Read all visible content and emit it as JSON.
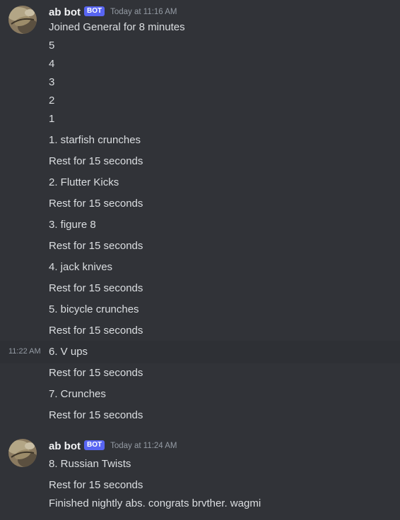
{
  "messages": [
    {
      "author": "ab bot",
      "tag": "BOT",
      "timestamp": "Today at 11:16 AM",
      "lines": [
        "Joined General for 8 minutes",
        "5",
        "4",
        "3",
        "2",
        "1",
        "1. starfish crunches",
        "Rest for 15 seconds",
        "2. Flutter Kicks",
        "Rest for 15 seconds",
        "3. figure 8",
        "Rest for 15 seconds",
        "4. jack knives",
        "Rest for 15 seconds",
        "5. bicycle crunches",
        "Rest for 15 seconds",
        "6. V ups",
        "Rest for 15 seconds",
        "7. Crunches",
        "Rest for 15 seconds"
      ],
      "hovered_line_time": "11:22 AM"
    },
    {
      "author": "ab bot",
      "tag": "BOT",
      "timestamp": "Today at 11:24 AM",
      "lines": [
        "8. Russian Twists",
        "Rest for 15 seconds",
        "Finished nightly abs. congrats brvther. wagmi"
      ]
    }
  ],
  "colors": {
    "background": "#313338",
    "hover_background": "#2e3035",
    "bot_tag": "#5865f2",
    "username": "#f2f3f5",
    "text": "#dbdee1",
    "timestamp": "#949ba4"
  }
}
